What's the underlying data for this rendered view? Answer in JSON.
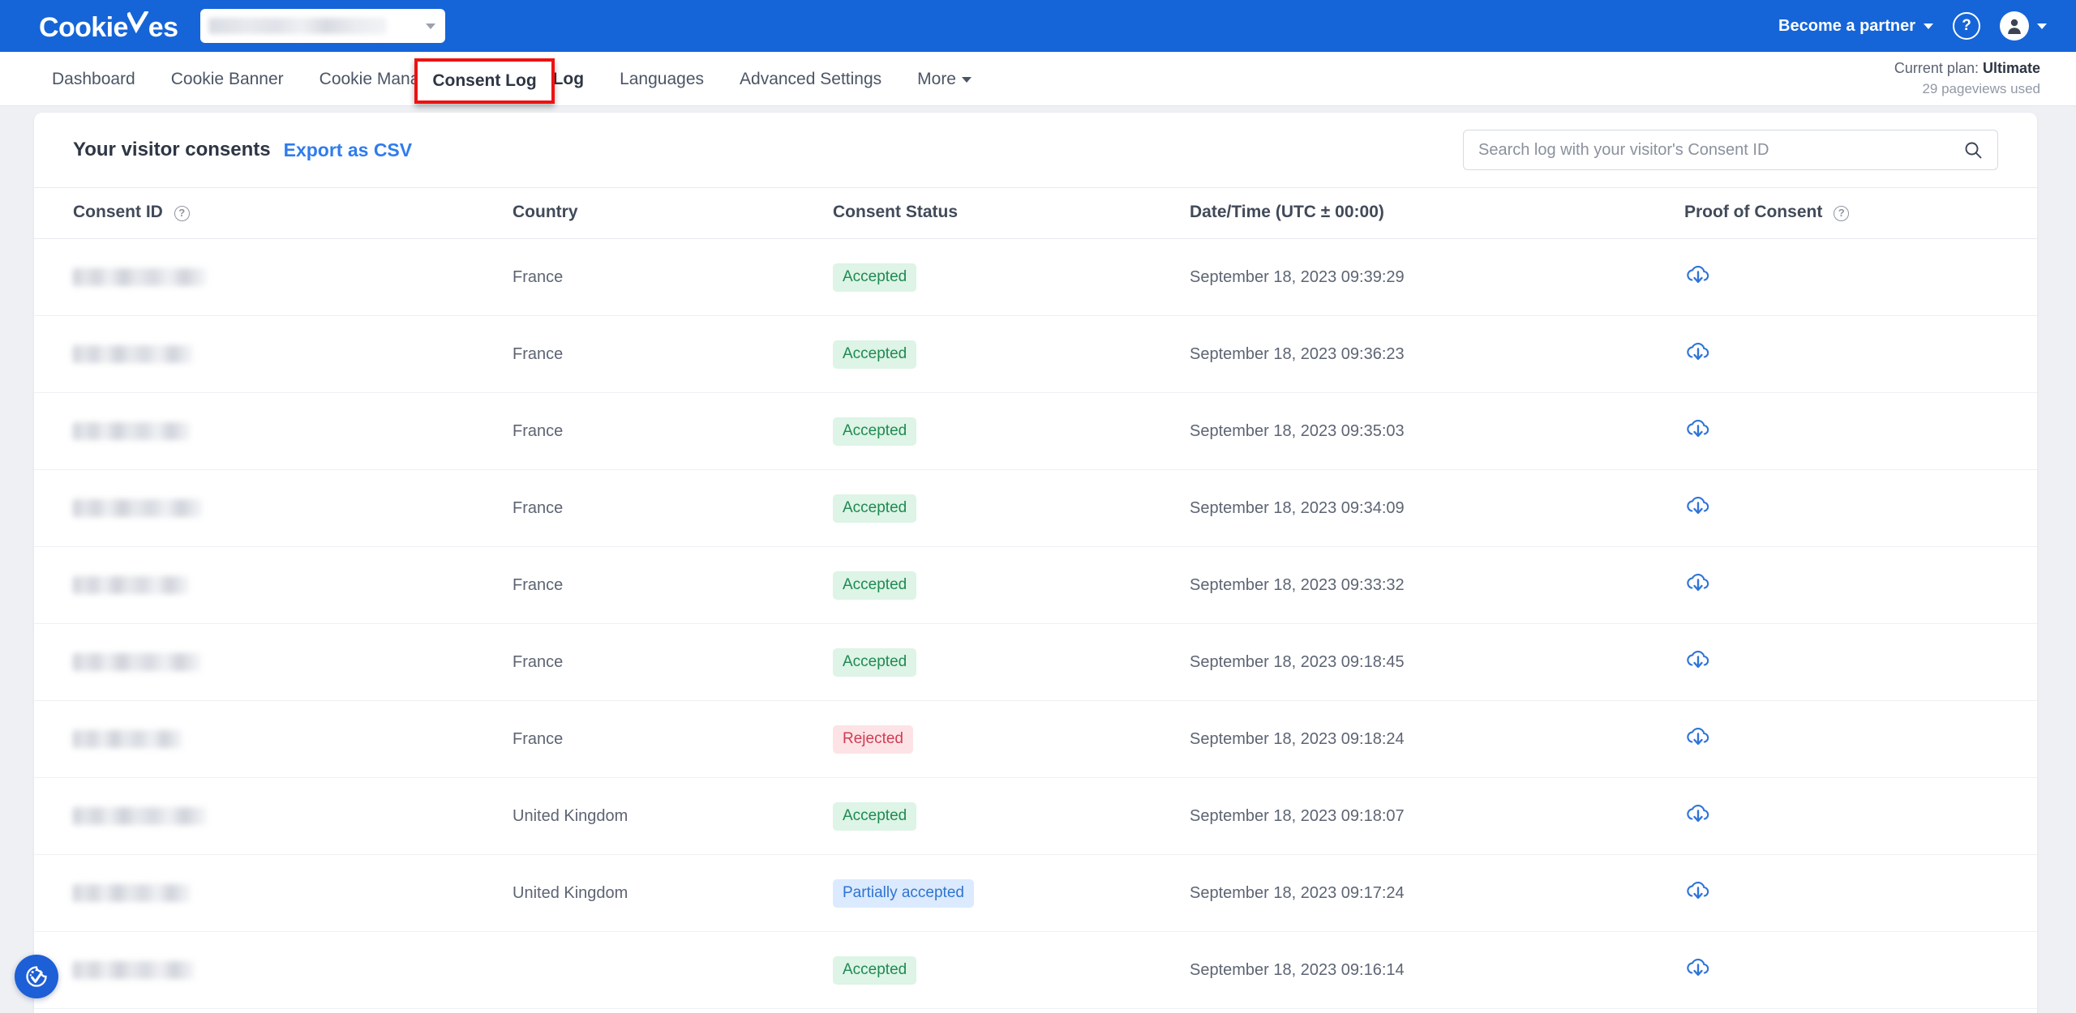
{
  "topbar": {
    "logo_text_1": "Cookie",
    "logo_text_2": "es",
    "site_selector_value": "",
    "partner_label": "Become a partner",
    "help_label": "?"
  },
  "nav": {
    "items": [
      {
        "label": "Dashboard",
        "active": false,
        "caret": false
      },
      {
        "label": "Cookie Banner",
        "active": false,
        "caret": false
      },
      {
        "label": "Cookie Manager",
        "active": false,
        "caret": false
      },
      {
        "label": "Consent Log",
        "active": true,
        "caret": false
      },
      {
        "label": "Languages",
        "active": false,
        "caret": false
      },
      {
        "label": "Advanced Settings",
        "active": false,
        "caret": false
      },
      {
        "label": "More",
        "active": false,
        "caret": true
      }
    ],
    "highlighted_item": "Consent Log",
    "highlight_color": "#ee1111"
  },
  "plan": {
    "prefix": "Current plan:",
    "name": "Ultimate",
    "usage": "29 pageviews used"
  },
  "card": {
    "title": "Your visitor consents",
    "export_label": "Export as CSV",
    "search_placeholder": "Search log with your visitor's Consent ID",
    "search_value": ""
  },
  "table": {
    "headers": {
      "consent_id": "Consent ID",
      "country": "Country",
      "consent_status": "Consent Status",
      "datetime": "Date/Time (UTC ± 00:00)",
      "proof": "Proof of Consent"
    },
    "rows": [
      {
        "consent_id": "",
        "id_redacted": true,
        "id_width": 165,
        "country": "France",
        "status": "Accepted",
        "status_kind": "accepted",
        "datetime": "September 18, 2023 09:39:29",
        "proof": "download-cloud-icon"
      },
      {
        "consent_id": "",
        "id_redacted": true,
        "id_width": 148,
        "country": "France",
        "status": "Accepted",
        "status_kind": "accepted",
        "datetime": "September 18, 2023 09:36:23",
        "proof": "download-cloud-icon"
      },
      {
        "consent_id": "",
        "id_redacted": true,
        "id_width": 145,
        "country": "France",
        "status": "Accepted",
        "status_kind": "accepted",
        "datetime": "September 18, 2023 09:35:03",
        "proof": "download-cloud-icon"
      },
      {
        "consent_id": "",
        "id_redacted": true,
        "id_width": 160,
        "country": "France",
        "status": "Accepted",
        "status_kind": "accepted",
        "datetime": "September 18, 2023 09:34:09",
        "proof": "download-cloud-icon"
      },
      {
        "consent_id": "",
        "id_redacted": true,
        "id_width": 143,
        "country": "France",
        "status": "Accepted",
        "status_kind": "accepted",
        "datetime": "September 18, 2023 09:33:32",
        "proof": "download-cloud-icon"
      },
      {
        "consent_id": "",
        "id_redacted": true,
        "id_width": 158,
        "country": "France",
        "status": "Accepted",
        "status_kind": "accepted",
        "datetime": "September 18, 2023 09:18:45",
        "proof": "download-cloud-icon"
      },
      {
        "consent_id": "",
        "id_redacted": true,
        "id_width": 135,
        "country": "France",
        "status": "Rejected",
        "status_kind": "rejected",
        "datetime": "September 18, 2023 09:18:24",
        "proof": "download-cloud-icon"
      },
      {
        "consent_id": "",
        "id_redacted": true,
        "id_width": 165,
        "country": "United Kingdom",
        "status": "Accepted",
        "status_kind": "accepted",
        "datetime": "September 18, 2023 09:18:07",
        "proof": "download-cloud-icon"
      },
      {
        "consent_id": "",
        "id_redacted": true,
        "id_width": 145,
        "country": "United Kingdom",
        "status": "Partially accepted",
        "status_kind": "partial",
        "datetime": "September 18, 2023 09:17:24",
        "proof": "download-cloud-icon"
      },
      {
        "consent_id": "",
        "id_redacted": true,
        "id_width": 150,
        "country": "",
        "status": "Accepted",
        "status_kind": "accepted",
        "datetime": "September 18, 2023 09:16:14",
        "proof": "download-cloud-icon"
      }
    ]
  },
  "widget": {
    "name": "cookie-consent-widget"
  },
  "colors": {
    "brand_blue": "#1565d8",
    "link_blue": "#2f7ced",
    "accepted_bg": "#ddf4e6",
    "accepted_fg": "#1f8a52",
    "rejected_bg": "#fde3e6",
    "rejected_fg": "#cf3c52",
    "partial_bg": "#dbeafe",
    "partial_fg": "#2f74d0",
    "highlight_red": "#ee1111"
  }
}
